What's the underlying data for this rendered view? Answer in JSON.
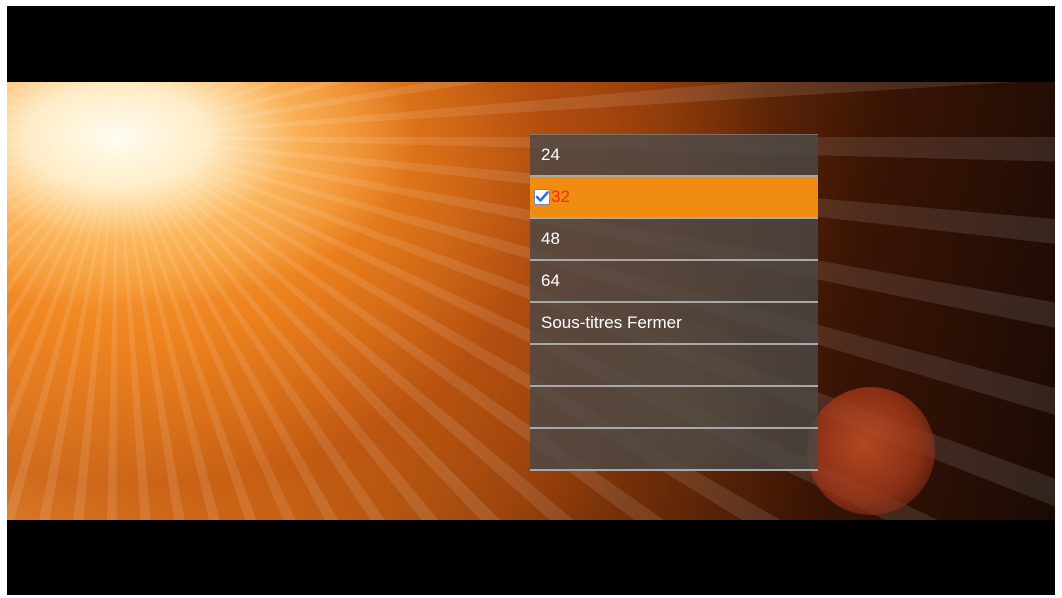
{
  "subtitle_menu": {
    "items": [
      {
        "label": "24",
        "selected": false
      },
      {
        "label": "32",
        "selected": true
      },
      {
        "label": "48",
        "selected": false
      },
      {
        "label": "64",
        "selected": false
      },
      {
        "label": "Sous-titres Fermer",
        "selected": false
      },
      {
        "label": "",
        "selected": false
      },
      {
        "label": "",
        "selected": false
      },
      {
        "label": "",
        "selected": false
      }
    ],
    "check_icon": "checkbox-checked-icon"
  },
  "colors": {
    "highlight": "#f08c10",
    "selected_text": "#ff2a18",
    "menu_text": "#ffffff"
  }
}
